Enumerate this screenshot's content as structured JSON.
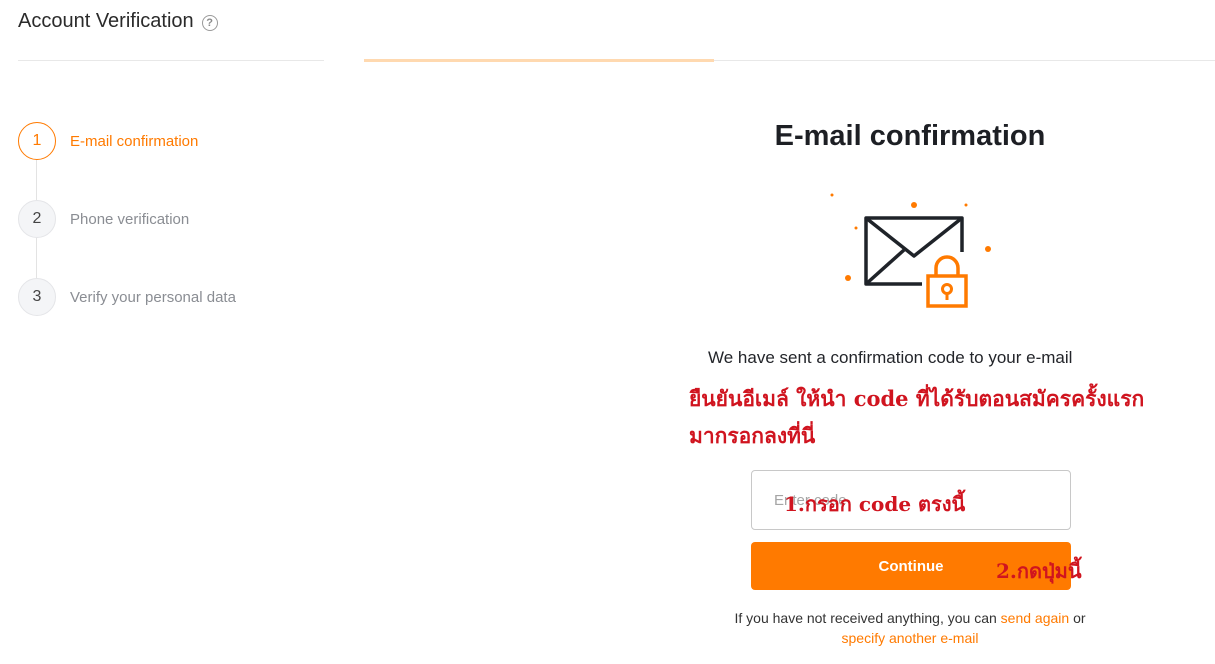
{
  "header": {
    "title": "Account Verification",
    "help_icon": "?"
  },
  "steps": [
    {
      "number": "1",
      "label": "E-mail confirmation",
      "active": true
    },
    {
      "number": "2",
      "label": "Phone verification",
      "active": false
    },
    {
      "number": "3",
      "label": "Verify your personal data",
      "active": false
    }
  ],
  "main": {
    "title": "E-mail confirmation",
    "illustration_icon": "envelope-lock-icon",
    "description": "We have sent a confirmation code to your e-mail",
    "code_placeholder": "Enter code",
    "continue_label": "Continue",
    "footer_prefix": "If you have not received anything, you can",
    "send_again": "send again",
    "or": "or",
    "specify_email": "specify another e-mail"
  },
  "annotations": {
    "note1_line1": "ยืนยันอีเมล์ ให้นำ code ที่ได้รับตอนสมัครครั้งแรก",
    "note1_line2": "มากรอกลงที่นี่",
    "note2": "1.กรอก code ตรงนี้",
    "note3": "2.กดปุ่มนี้"
  },
  "colors": {
    "accent": "#ff7a00",
    "annotation": "#d0141f",
    "text": "#1d1f24"
  }
}
